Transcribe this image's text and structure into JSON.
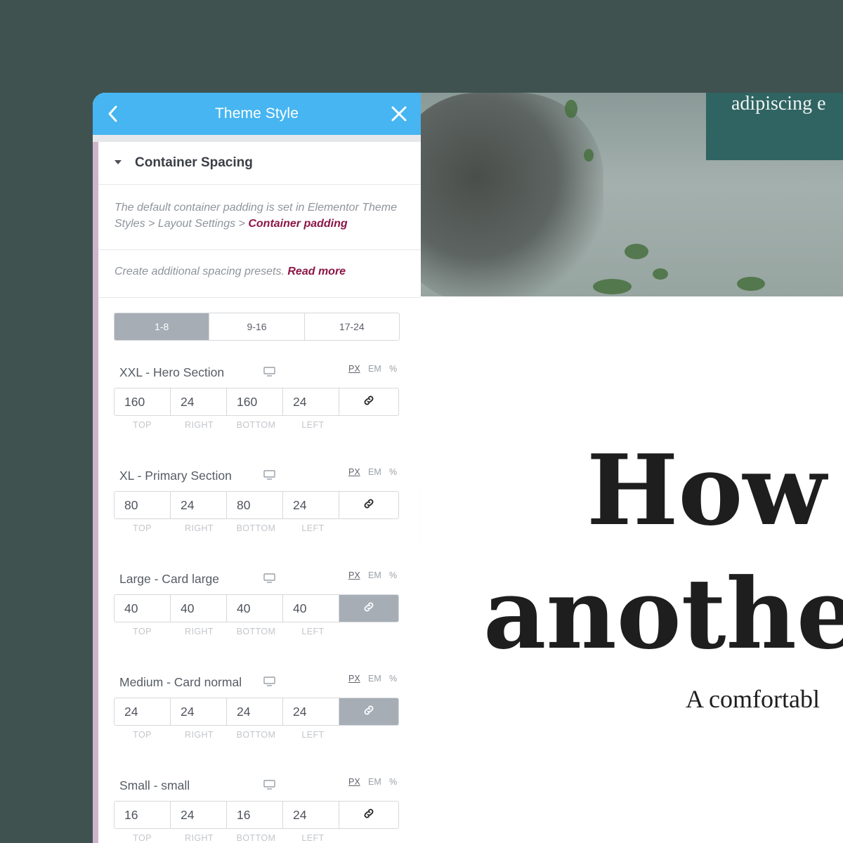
{
  "panel": {
    "title": "Theme Style",
    "back_icon": "chevron-left-icon",
    "close_icon": "close-icon",
    "section_title": "Container Spacing",
    "note1_text": "The default container padding is set in Elementor Theme Styles > Layout Settings > ",
    "note1_link": "Container padding",
    "note2_text": "Create additional spacing presets. ",
    "note2_link": "Read more",
    "tabs": [
      "1-8",
      "9-16",
      "17-24"
    ],
    "active_tab": "1-8",
    "units": [
      "PX",
      "EM",
      "%"
    ],
    "selected_unit": "PX",
    "side_labels": [
      "TOP",
      "RIGHT",
      "BOTTOM",
      "LEFT"
    ],
    "presets": [
      {
        "name": "XXL - Hero Section",
        "top": "160",
        "right": "24",
        "bottom": "160",
        "left": "24",
        "linked": false
      },
      {
        "name": "XL - Primary Section",
        "top": "80",
        "right": "24",
        "bottom": "80",
        "left": "24",
        "linked": false
      },
      {
        "name": "Large - Card large",
        "top": "40",
        "right": "40",
        "bottom": "40",
        "left": "40",
        "linked": true
      },
      {
        "name": "Medium - Card normal",
        "top": "24",
        "right": "24",
        "bottom": "24",
        "left": "24",
        "linked": true
      },
      {
        "name": "Small -  small",
        "top": "16",
        "right": "24",
        "bottom": "16",
        "left": "24",
        "linked": false
      }
    ]
  },
  "preview": {
    "teal_box_text": "adipiscing e",
    "headline_line1": "How t",
    "headline_line2": "anothen",
    "subline": "A comfortabl"
  },
  "colors": {
    "background": "#3f5250",
    "header_blue": "#46b5f1",
    "link_magenta": "#8b1747",
    "active_gray": "#a6adb5",
    "teal_box": "#2f6462",
    "left_accent": "#cdb4cb"
  }
}
